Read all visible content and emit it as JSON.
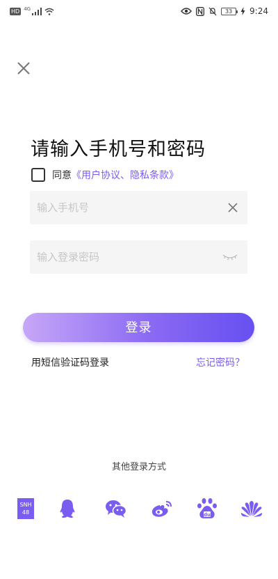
{
  "status_bar": {
    "hd": "HD",
    "network": "4G",
    "battery": "33",
    "time": "9:24"
  },
  "icons": {
    "close": "close-icon",
    "clear": "clear-icon",
    "eye_closed": "eye-closed-icon",
    "snh48": "snh48-icon",
    "qq": "qq-icon",
    "wechat": "wechat-icon",
    "weibo": "weibo-icon",
    "baidu": "baidu-icon",
    "huawei": "huawei-icon"
  },
  "title": "请输入手机号和密码",
  "agreement": {
    "prefix": "同意",
    "link": "《用户协议、隐私条款》"
  },
  "phone": {
    "placeholder": "输入手机号",
    "value": ""
  },
  "password": {
    "placeholder": "输入登录密码",
    "value": ""
  },
  "login_label": "登录",
  "sms_login": "用短信验证码登录",
  "forgot_password": "忘记密码？",
  "other_login": "其他登录方式",
  "social": {
    "snh48_logo_text": [
      "SNH",
      "48"
    ]
  },
  "colors": {
    "accent": "#7a5cf0",
    "gradient_start": "#c6a7f7",
    "gradient_end": "#6650f1",
    "input_bg": "#f5f5f5"
  }
}
